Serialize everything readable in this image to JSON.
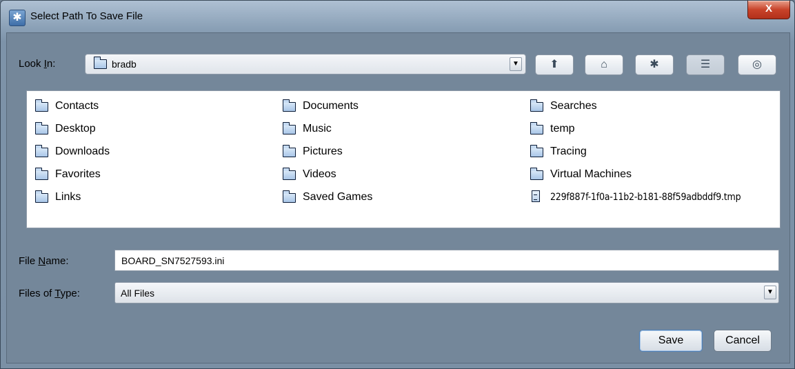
{
  "window": {
    "title": "Select Path To Save File",
    "close_label": "X"
  },
  "lookin": {
    "label_pre": "Look ",
    "label_mnemonic": "I",
    "label_post": "n:",
    "value": "bradb"
  },
  "toolbar": [
    {
      "name": "up-one-level-button",
      "icon": "folder-up-icon",
      "glyph": "⬆",
      "pressed": false
    },
    {
      "name": "home-button",
      "icon": "home-icon",
      "glyph": "⌂",
      "pressed": false
    },
    {
      "name": "new-folder-button",
      "icon": "new-folder-icon",
      "glyph": "✱",
      "pressed": false
    },
    {
      "name": "list-view-button",
      "icon": "list-view-icon",
      "glyph": "☰",
      "pressed": true
    },
    {
      "name": "details-view-button",
      "icon": "details-view-icon",
      "glyph": "◎",
      "pressed": false
    }
  ],
  "files": {
    "col1": [
      "Contacts",
      "Desktop",
      "Downloads",
      "Favorites",
      "Links"
    ],
    "col2": [
      "Documents",
      "Music",
      "Pictures",
      "Videos",
      "Saved Games"
    ],
    "col3": [
      "Searches",
      "temp",
      "Tracing",
      "Virtual Machines"
    ],
    "tmp_file": "229f887f-1f0a-11b2-b181-88f59adbddf9.tmp"
  },
  "filename": {
    "label_pre": "File ",
    "label_mnemonic": "N",
    "label_post": "ame:",
    "value": "BOARD_SN7527593.ini"
  },
  "filetype": {
    "label_pre": "Files of ",
    "label_mnemonic": "T",
    "label_post": "ype:",
    "value": "All Files"
  },
  "buttons": {
    "save": "Save",
    "cancel": "Cancel"
  },
  "colors": {
    "dialog_bg": "#74879a",
    "close_button": "#c8432a"
  }
}
